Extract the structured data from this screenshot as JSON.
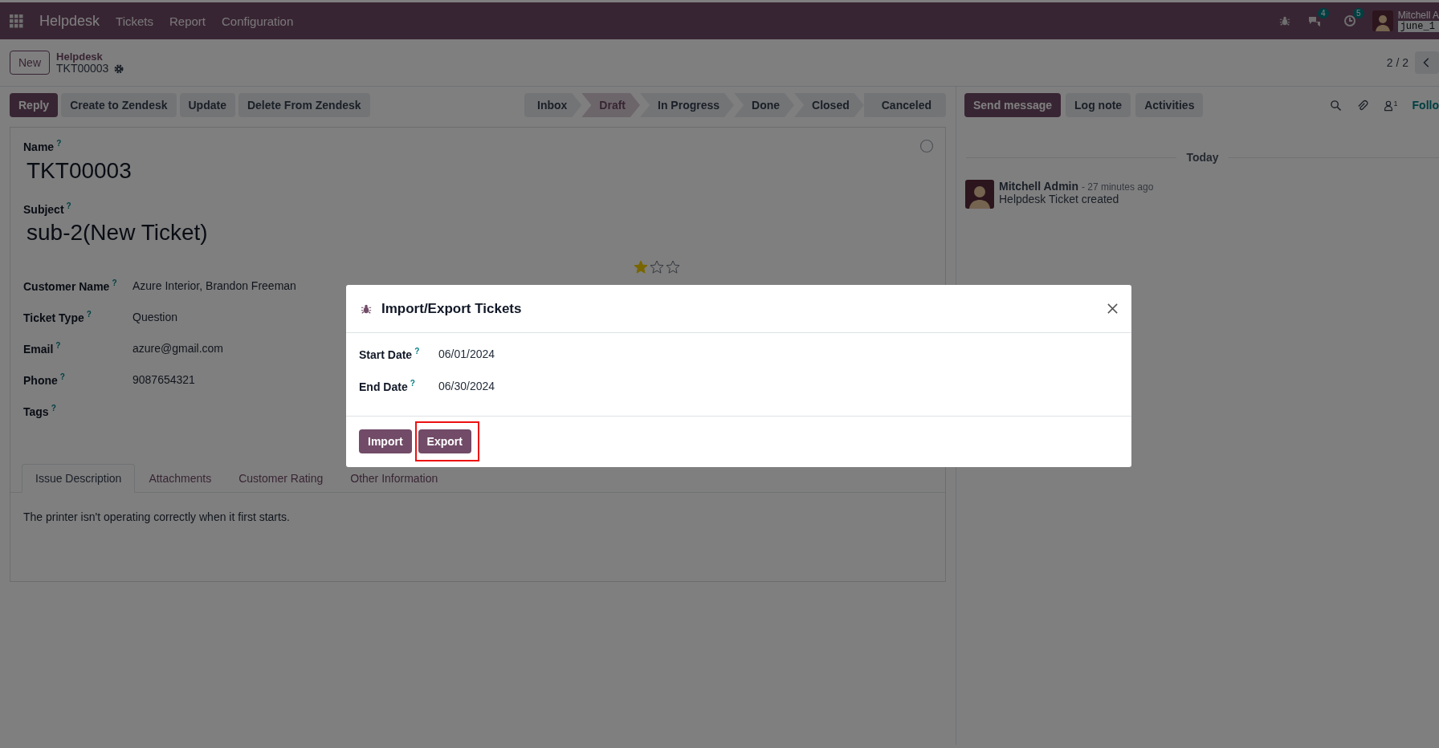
{
  "navbar": {
    "app": "Helpdesk",
    "menus": [
      "Tickets",
      "Report",
      "Configuration"
    ],
    "messages_count": "4",
    "activities_count": "5",
    "user_name": "Mitchell A",
    "database": "june_1"
  },
  "control_panel": {
    "new_button": "New",
    "breadcrumb_parent": "Helpdesk",
    "record": "TKT00003",
    "pager": "2 / 2"
  },
  "action_buttons": [
    {
      "label": "Reply",
      "primary": true
    },
    {
      "label": "Create to Zendesk",
      "primary": false
    },
    {
      "label": "Update",
      "primary": false
    },
    {
      "label": "Delete From Zendesk",
      "primary": false
    }
  ],
  "stages": [
    {
      "label": "Inbox",
      "selected": false
    },
    {
      "label": "Draft",
      "selected": true
    },
    {
      "label": "In Progress",
      "selected": false
    },
    {
      "label": "Done",
      "selected": false
    },
    {
      "label": "Closed",
      "selected": false
    },
    {
      "label": "Canceled",
      "selected": false
    }
  ],
  "form": {
    "name_label": "Name",
    "name_help": "?",
    "name": "TKT00003",
    "subject_label": "Subject",
    "subject_help": "?",
    "subject": "sub-2(New Ticket)",
    "fields": [
      {
        "label": "Customer Name",
        "help": "?",
        "value": "Azure Interior, Brandon Freeman"
      },
      {
        "label": "Ticket Type",
        "help": "?",
        "value": "Question"
      },
      {
        "label": "Email",
        "help": "?",
        "value": "azure@gmail.com"
      },
      {
        "label": "Phone",
        "help": "?",
        "value": "9087654321"
      },
      {
        "label": "Tags",
        "help": "?"
      }
    ],
    "priority": {
      "stars": 1
    },
    "tabs": [
      {
        "label": "Issue Description",
        "selected": true
      },
      {
        "label": "Attachments",
        "selected": false
      },
      {
        "label": "Customer Rating",
        "selected": false
      },
      {
        "label": "Other Information",
        "selected": false
      }
    ],
    "description": "The printer isn't operating correctly when it first starts."
  },
  "chatter": {
    "buttons": [
      {
        "label": "Send message",
        "primary": true
      },
      {
        "label": "Log note",
        "primary": false
      },
      {
        "label": "Activities",
        "primary": false
      }
    ],
    "followers_count": "1",
    "follow": "Follo",
    "date_separator": "Today",
    "messages": [
      {
        "author": "Mitchell Admin",
        "time": "- 27 minutes ago",
        "body": "Helpdesk Ticket created"
      }
    ]
  },
  "dialog": {
    "title": "Import/Export Tickets",
    "fields": [
      {
        "label": "Start Date",
        "help": "?",
        "value": "06/01/2024"
      },
      {
        "label": "End Date",
        "help": "?",
        "value": "06/30/2024"
      }
    ],
    "buttons": [
      {
        "label": "Import",
        "highlighted": false
      },
      {
        "label": "Export",
        "highlighted": true
      }
    ]
  }
}
